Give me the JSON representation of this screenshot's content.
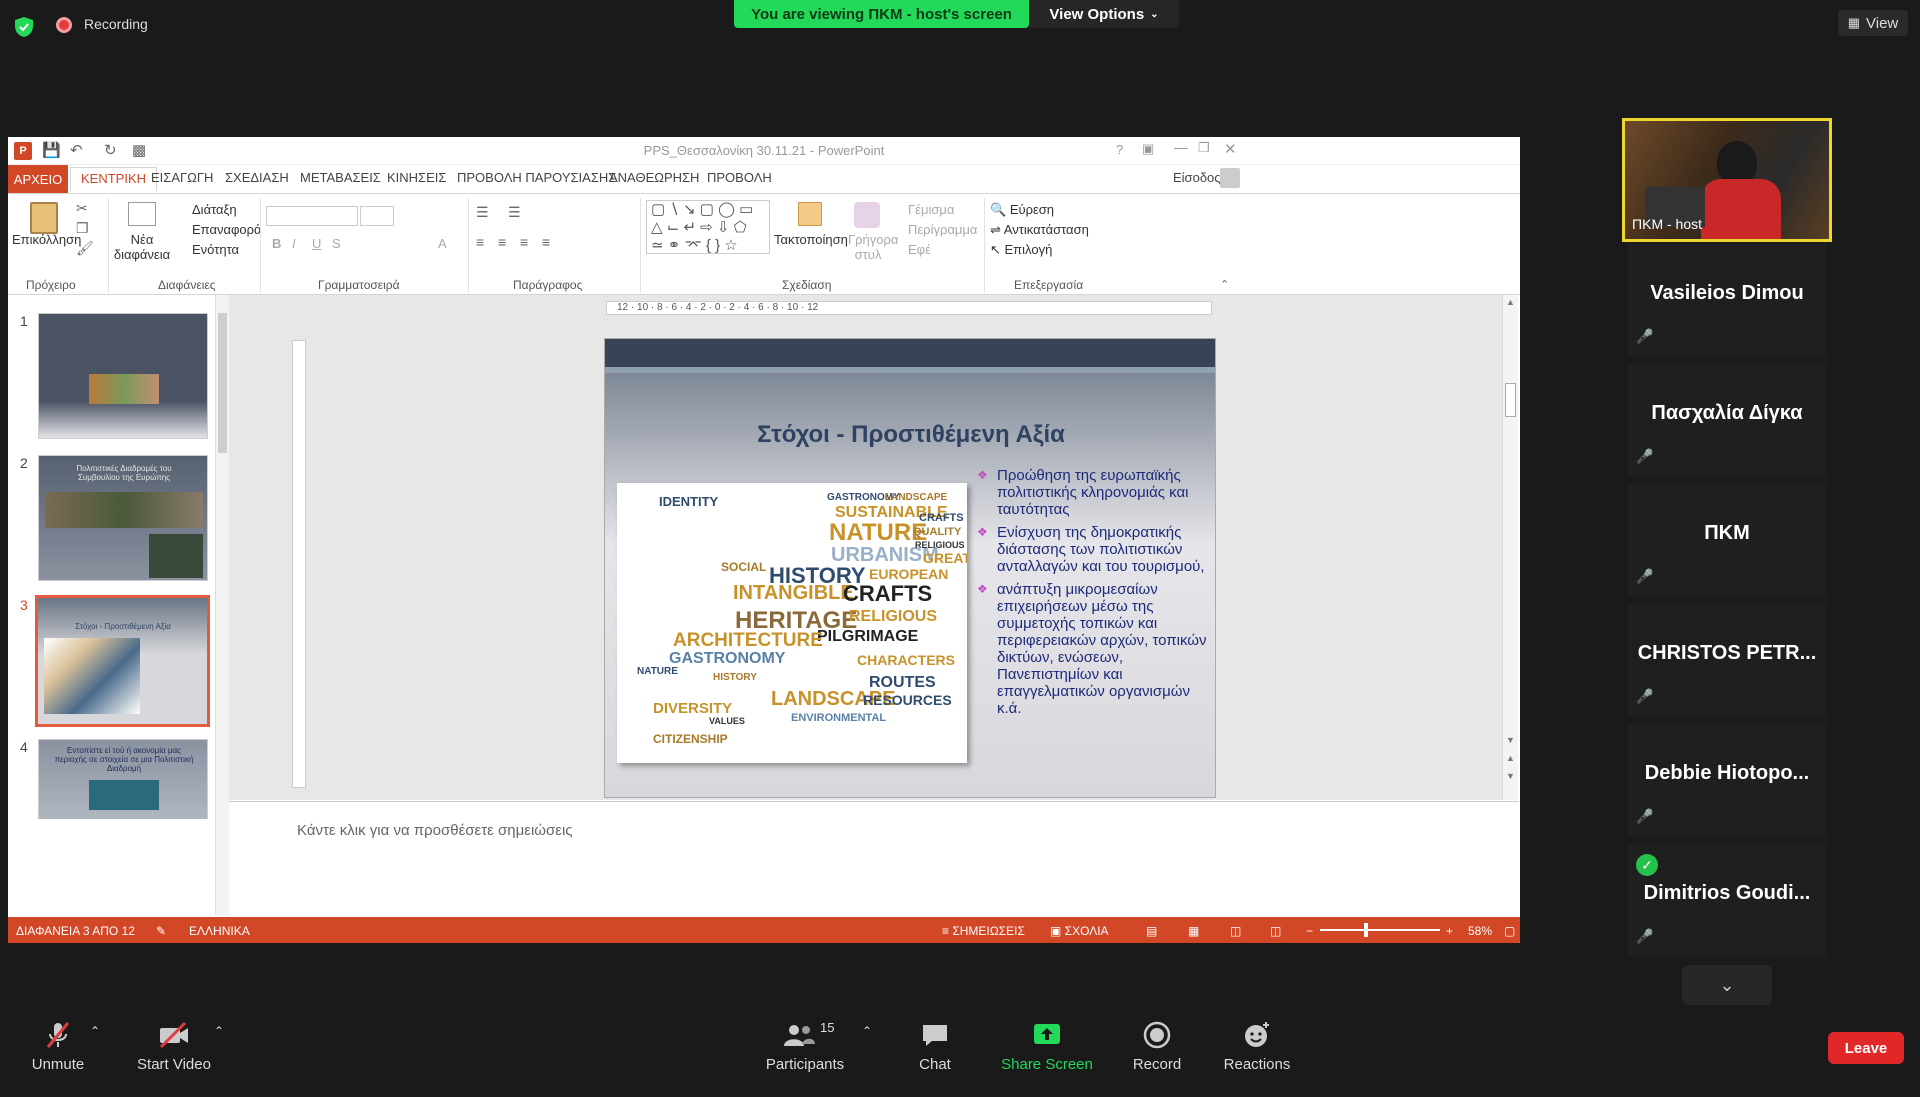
{
  "zoom": {
    "recording_label": "Recording",
    "viewing_banner": "You are viewing ΠΚΜ - host's screen",
    "view_options": "View Options",
    "view_button": "View"
  },
  "ppt": {
    "doc_title": "PPS_Θεσσαλονίκη 30.11.21 - PowerPoint",
    "signin": "Είσοδος",
    "tabs": [
      "ΑΡΧΕΙΟ",
      "ΚΕΝΤΡΙΚΗ",
      "ΕΙΣΑΓΩΓΗ",
      "ΣΧΕΔΙΑΣΗ",
      "ΜΕΤΑΒΑΣΕΙΣ",
      "ΚΙΝΗΣΕΙΣ",
      "ΠΡΟΒΟΛΗ ΠΑΡΟΥΣΙΑΣΗΣ",
      "ΑΝΑΘΕΩΡΗΣΗ",
      "ΠΡΟΒΟΛΗ"
    ],
    "ribbon": {
      "paste": "Επικόλληση",
      "new_slide": "Νέα διαφάνεια",
      "layout": "Διάταξη",
      "reset": "Επαναφορά",
      "section": "Ενότητα",
      "arrange": "Τακτοποίηση",
      "quick_styles": "Γρήγορα στυλ",
      "fill": "Γέμισμα",
      "outline": "Περίγραμμα",
      "effects": "Εφέ",
      "find": "Εύρεση",
      "replace": "Αντικατάσταση",
      "select": "Επιλογή",
      "groups": [
        "Πρόχειρο",
        "Διαφάνειες",
        "Γραμματοσειρά",
        "Παράγραφος",
        "Σχεδίαση",
        "Επεξεργασία"
      ]
    },
    "slide": {
      "title": "Στόχοι - Προστιθέμενη Αξία",
      "bullets": [
        "Προώθηση της ευρωπαϊκής πολιτιστικής κληρονομιάς και ταυτότητας",
        "Ενίσχυση της δημοκρατικής διάστασης των πολιτιστικών ανταλλαγών και του τουρισμού,",
        "ανάπτυξη μικρομεσαίων επιχειρήσεων μέσω της συμμετοχής τοπικών και περιφερειακών αρχών, τοπικών δικτύων, ενώσεων, Πανεπιστημίων και επαγγελματικών οργανισμών κ.ά."
      ],
      "cloud_words": [
        "IDENTITY",
        "GASTRONOMY",
        "LANDSCAPE",
        "SUSTAINABLE",
        "NATURE",
        "URBANISM",
        "CRAFTS",
        "QUALITY",
        "RELIGIOUS",
        "HISTORY",
        "EUROPEAN",
        "GREAT",
        "SOCIAL",
        "INTANGIBLE",
        "CRAFTS",
        "HERITAGE",
        "RELIGIOUS",
        "PILGRIMAGE",
        "ARCHITECTURE",
        "GASTRONOMY",
        "CHARACTERS",
        "NATURE",
        "HISTORY",
        "ROUTES",
        "LANDSCAPE",
        "RESOURCES",
        "DIVERSITY",
        "ENVIRONMENTAL",
        "CITIZENSHIP",
        "VALUES"
      ]
    },
    "thumbs": {
      "numbers": [
        "1",
        "2",
        "3",
        "4"
      ],
      "t2_title": "Πολιτιστικές Διαδρομές του Συμβουλίου της Ευρώπης",
      "t3_title": "Στόχοι - Προστιθέμενη Αξία",
      "t4_title": "Εντοπίστε εί τού ή ακονομία μας περιοχής σε στοιχεία σε μια Πολιτιστική Διαδρομή"
    },
    "notes_placeholder": "Κάντε κλικ για να προσθέσετε σημειώσεις",
    "status": {
      "slide_count": "ΔΙΑΦΑΝΕΙΑ 3 ΑΠΟ 12",
      "language": "ΕΛΛΗΝΙΚΑ",
      "notes": "ΣΗΜΕΙΩΣΕΙΣ",
      "comments": "ΣΧΟΛΙΑ",
      "zoom": "58%"
    }
  },
  "participants": {
    "host_label": "ΠΚΜ - host",
    "names": [
      "Vasileios Dimou",
      "Πασχαλία Δίγκα",
      "ΠΚΜ",
      "CHRISTOS PETR...",
      "Debbie Hiotopo...",
      "Dimitrios Goudi..."
    ]
  },
  "toolbar": {
    "unmute": "Unmute",
    "start_video": "Start Video",
    "participants": "Participants",
    "participant_count": "15",
    "chat": "Chat",
    "share_screen": "Share Screen",
    "record": "Record",
    "reactions": "Reactions",
    "leave": "Leave"
  }
}
